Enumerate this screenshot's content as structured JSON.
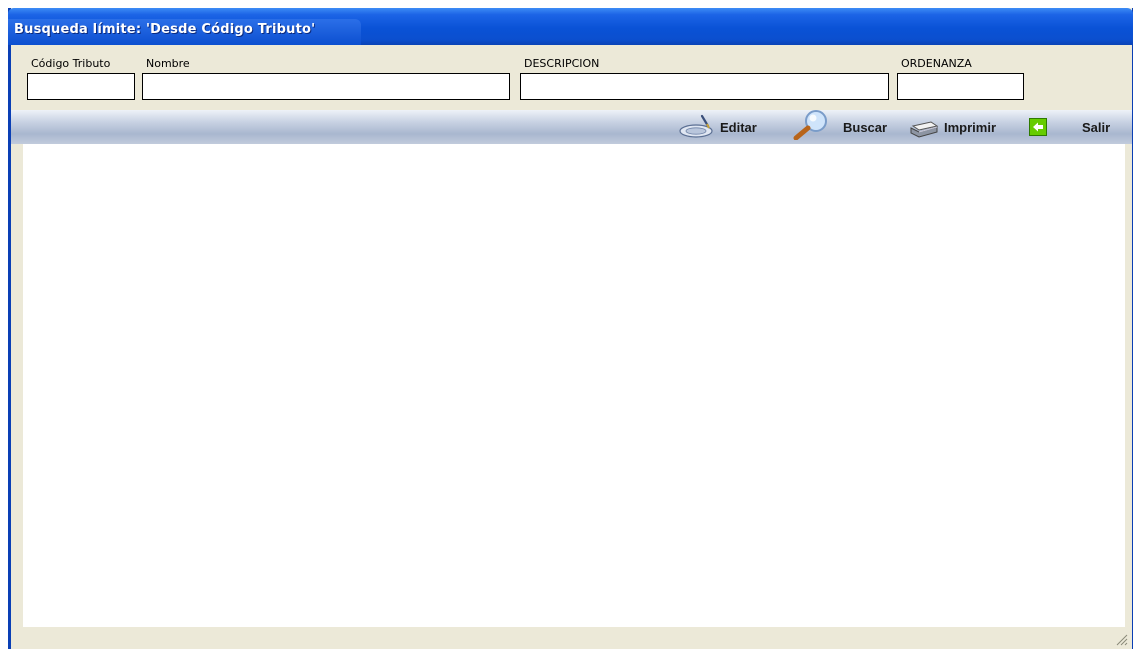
{
  "window": {
    "title": "Busqueda límite: 'Desde Código Tributo'"
  },
  "filters": {
    "codigo_tributo": {
      "label": "Código Tributo",
      "value": ""
    },
    "nombre": {
      "label": "Nombre",
      "value": ""
    },
    "descripcion": {
      "label": "DESCRIPCION",
      "value": ""
    },
    "ordenanza": {
      "label": "ORDENANZA",
      "value": ""
    }
  },
  "toolbar": {
    "editar": {
      "label": "Editar",
      "icon": "edit-pen-icon"
    },
    "buscar": {
      "label": "Buscar",
      "icon": "magnifier-icon"
    },
    "imprimir": {
      "label": "Imprimir",
      "icon": "printer-icon"
    },
    "salir": {
      "label": "Salir",
      "icon": "exit-arrow-icon"
    }
  },
  "colors": {
    "titlebar": "#0a52d6",
    "window_bg": "#ece9d8",
    "exit_green": "#66cc00"
  }
}
